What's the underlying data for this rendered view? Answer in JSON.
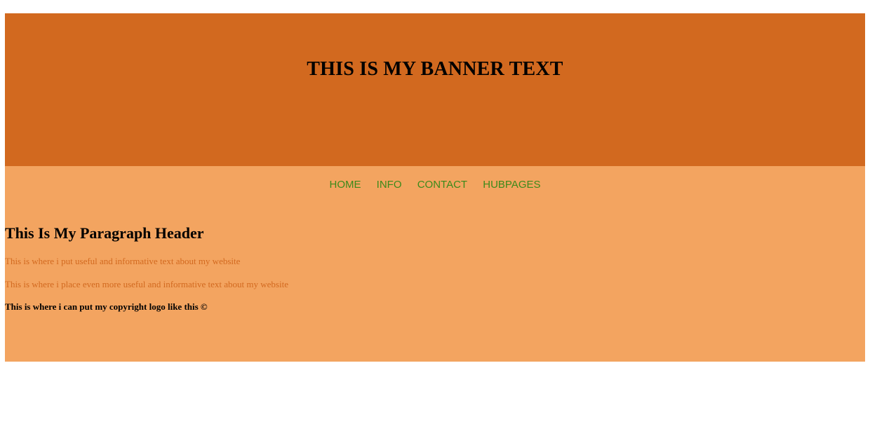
{
  "banner": {
    "title": "THIS IS MY BANNER TEXT"
  },
  "nav": {
    "items": [
      {
        "label": "HOME"
      },
      {
        "label": "INFO"
      },
      {
        "label": "CONTACT"
      },
      {
        "label": "HUBPAGES"
      }
    ]
  },
  "main": {
    "header": "This Is My Paragraph Header",
    "paragraphs": [
      "This is where i put useful and informative text about my website",
      "This is where i place even more useful and informative text about my website"
    ],
    "copyright": "This is where i can put my copyright logo like this ©"
  },
  "colors": {
    "banner_bg": "#d2691f",
    "site_bg": "#f3a460",
    "nav_link": "#3c8a1a",
    "paragraph_text": "#d2691f",
    "page_bg": "#ffffff"
  }
}
